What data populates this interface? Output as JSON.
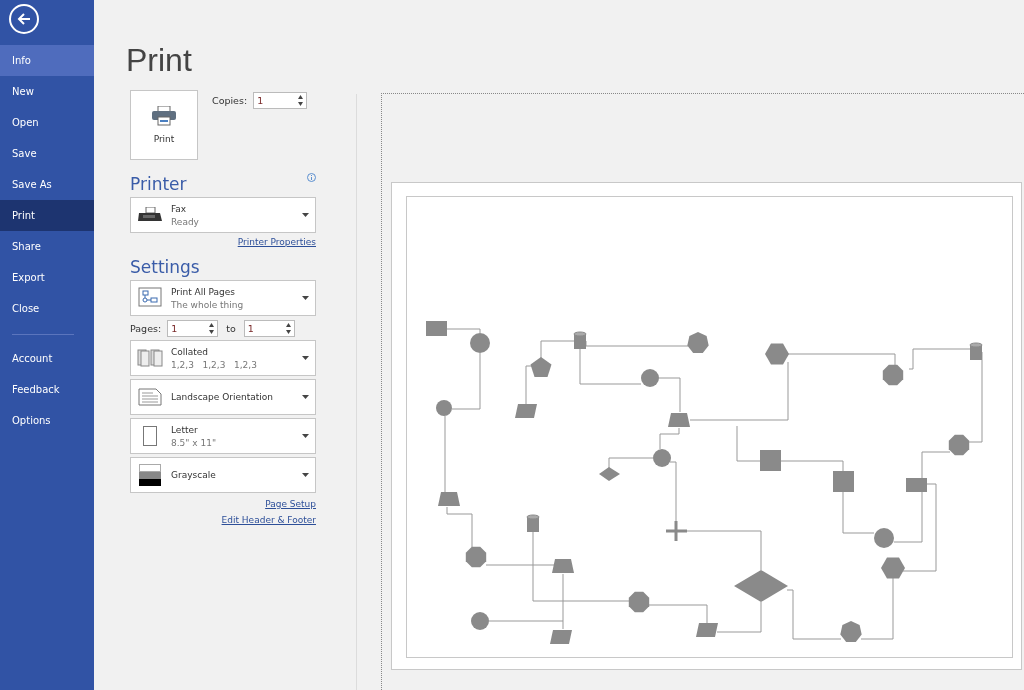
{
  "sidebar": {
    "groups": [
      [
        {
          "label": "Info",
          "selected": false,
          "hovered": true
        },
        {
          "label": "New",
          "selected": false,
          "hovered": false
        },
        {
          "label": "Open",
          "selected": false,
          "hovered": false
        },
        {
          "label": "Save",
          "selected": false,
          "hovered": false
        },
        {
          "label": "Save As",
          "selected": false,
          "hovered": false
        },
        {
          "label": "Print",
          "selected": true,
          "hovered": false
        },
        {
          "label": "Share",
          "selected": false,
          "hovered": false
        },
        {
          "label": "Export",
          "selected": false,
          "hovered": false
        },
        {
          "label": "Close",
          "selected": false,
          "hovered": false
        }
      ],
      [
        {
          "label": "Account",
          "selected": false,
          "hovered": false
        },
        {
          "label": "Feedback",
          "selected": false,
          "hovered": false
        },
        {
          "label": "Options",
          "selected": false,
          "hovered": false
        }
      ]
    ]
  },
  "page_title": "Print",
  "print_button": {
    "label": "Print"
  },
  "copies": {
    "label": "Copies:",
    "value": "1"
  },
  "printer": {
    "heading": "Printer",
    "name": "Fax",
    "status": "Ready",
    "link": "Printer Properties"
  },
  "settings": {
    "heading": "Settings",
    "dropdowns": [
      {
        "kind": "pages",
        "title": "Print All Pages",
        "subtitle": "The whole thing"
      },
      {
        "kind": "range"
      },
      {
        "kind": "collated",
        "title": "Collated",
        "subtitle": "1,2,3   1,2,3   1,2,3"
      },
      {
        "kind": "orientation",
        "title": "Landscape Orientation"
      },
      {
        "kind": "paper",
        "title": "Letter",
        "subtitle": "8.5\" x 11\""
      },
      {
        "kind": "color",
        "title": "Grayscale"
      }
    ],
    "pages": {
      "label": "Pages:",
      "from": "1",
      "to_label": "to",
      "to": "1"
    },
    "links": [
      "Page Setup",
      "Edit Header & Footer"
    ]
  }
}
